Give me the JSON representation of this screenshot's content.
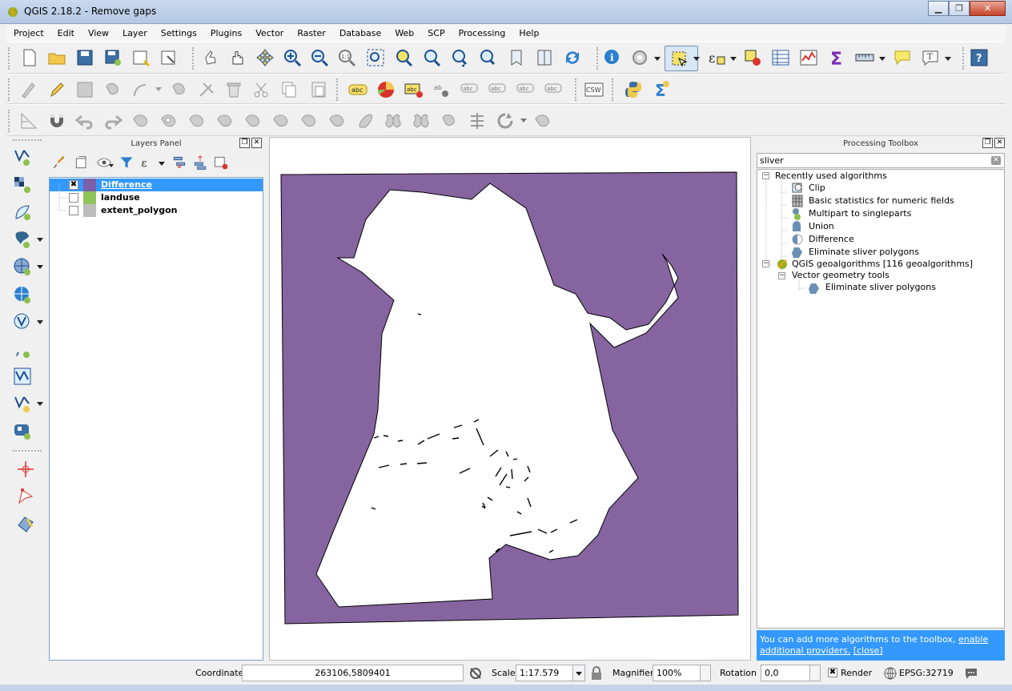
{
  "window": {
    "title": "QGIS 2.18.2 - Remove gaps"
  },
  "menu": [
    "Project",
    "Edit",
    "View",
    "Layer",
    "Settings",
    "Plugins",
    "Vector",
    "Raster",
    "Database",
    "Web",
    "SCP",
    "Processing",
    "Help"
  ],
  "layers_panel": {
    "title": "Layers Panel",
    "layers": [
      {
        "name": "Difference",
        "checked": "✖",
        "color": "#7b5fa8",
        "selected": true
      },
      {
        "name": "landuse",
        "checked": "",
        "color": "#8fc45a",
        "selected": false
      },
      {
        "name": "extent_polygon",
        "checked": "",
        "color": "#bdbdbd",
        "selected": false
      }
    ]
  },
  "map": {
    "fill_color": "#8664a0",
    "outline": "#000000"
  },
  "processing": {
    "title": "Processing Toolbox",
    "search_value": "sliver",
    "recent_group": "Recently used algorithms",
    "recent": [
      "Clip",
      "Basic statistics for numeric fields",
      "Multipart to singleparts",
      "Union",
      "Difference",
      "Eliminate sliver polygons"
    ],
    "provider": "QGIS geoalgorithms [116 geoalgorithms]",
    "subgroup": "Vector geometry tools",
    "sub_item": "Eliminate sliver polygons",
    "info_text": "You can add more algorithms to the toolbox,",
    "info_link": "enable additional providers.",
    "info_close": "[close]"
  },
  "status": {
    "coordinate_label": "Coordinate",
    "coordinate_value": "263106,5809401",
    "scale_label": "Scale",
    "scale_value": "1:17.579",
    "magnifier_label": "Magnifier",
    "magnifier_value": "100%",
    "rotation_label": "Rotation",
    "rotation_value": "0,0",
    "render_label": "Render",
    "render_check": "✖",
    "crs": "EPSG:32719"
  }
}
